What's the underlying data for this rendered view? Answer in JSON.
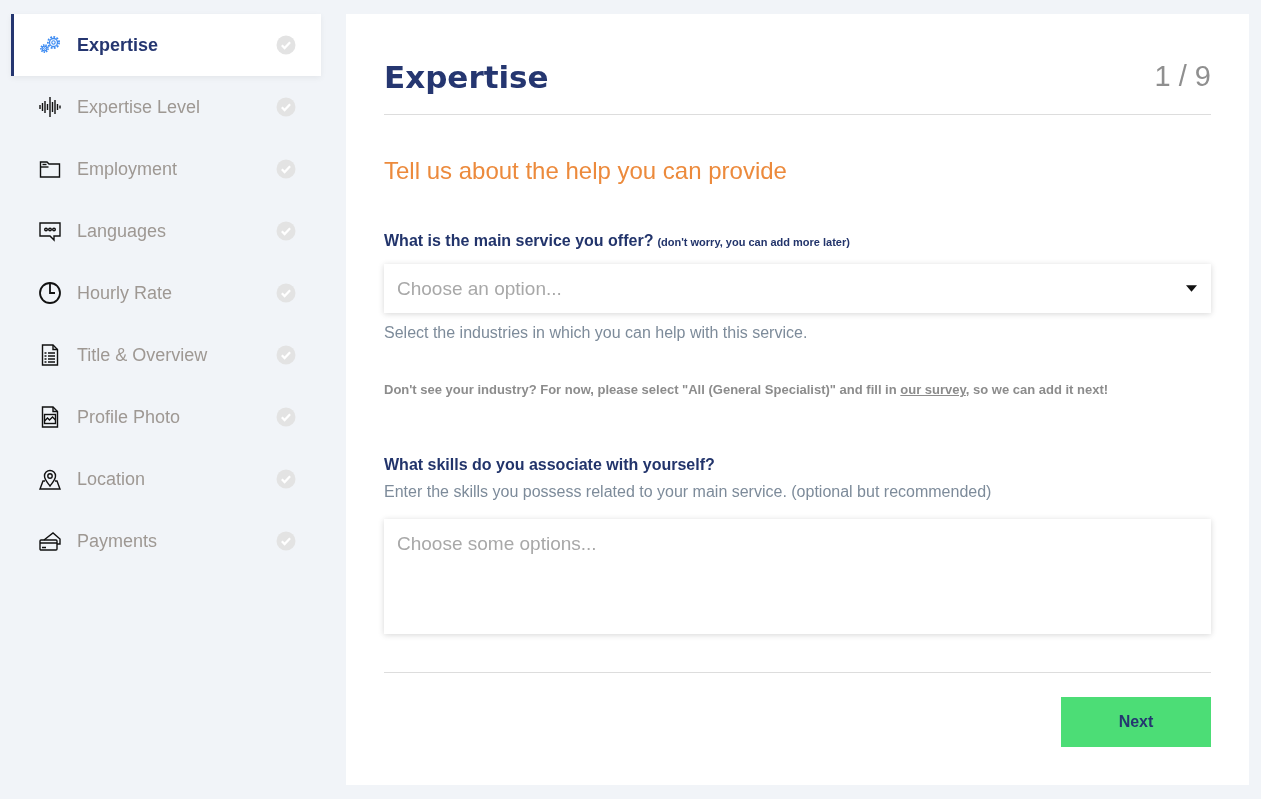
{
  "sidebar": {
    "items": [
      {
        "label": "Expertise",
        "selected": true,
        "completed": false
      },
      {
        "label": "Expertise Level",
        "selected": false,
        "completed": false
      },
      {
        "label": "Employment",
        "selected": false,
        "completed": false
      },
      {
        "label": "Languages",
        "selected": false,
        "completed": false
      },
      {
        "label": "Hourly Rate",
        "selected": false,
        "completed": false
      },
      {
        "label": "Title & Overview",
        "selected": false,
        "completed": false
      },
      {
        "label": "Profile Photo",
        "selected": false,
        "completed": false
      },
      {
        "label": "Location",
        "selected": false,
        "completed": false
      },
      {
        "label": "Payments",
        "selected": false,
        "completed": false
      }
    ]
  },
  "header": {
    "title": "Expertise",
    "step": "1 / 9"
  },
  "form": {
    "subtitle": "Tell us about the help you can provide",
    "service": {
      "label": "What is the main service you offer?",
      "note": "(don't worry, you can add more later)",
      "placeholder": "Choose an option...",
      "help": "Select the industries in which you can help with this service."
    },
    "notice": {
      "before": "Don't see your industry? For now, please select \"All (General Specialist)\" and fill in ",
      "link": "our survey",
      "after": ", so we can add it next!"
    },
    "skills": {
      "label": "What skills do you associate with yourself?",
      "hint": "Enter the skills you possess related to your main service. (optional but recommended)",
      "placeholder": "Choose some options..."
    }
  },
  "footer": {
    "next_button": "Next"
  }
}
